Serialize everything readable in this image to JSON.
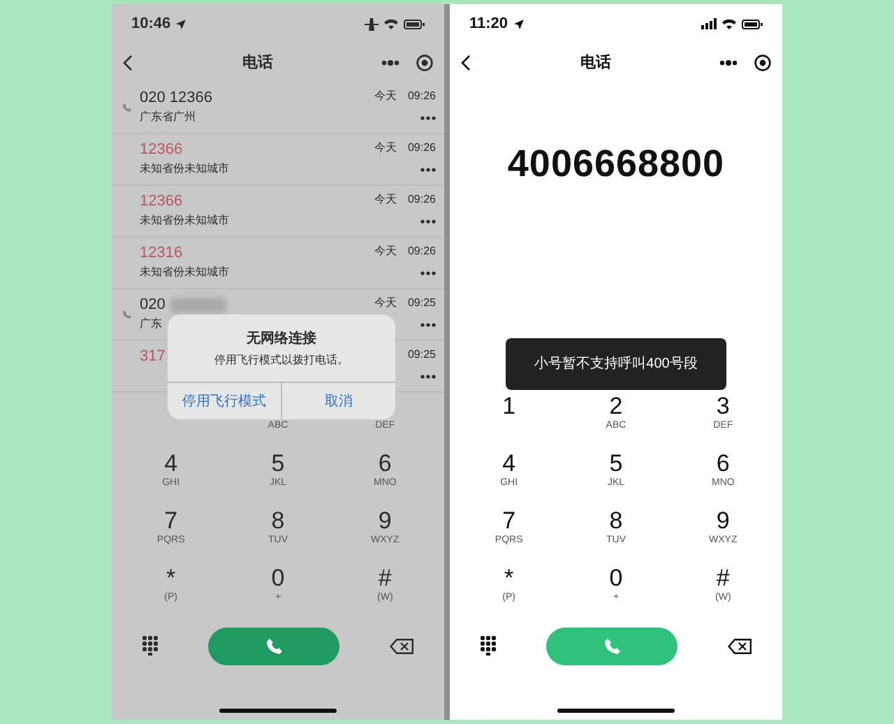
{
  "screens": [
    {
      "kind": "call_history",
      "dimmed": true,
      "status_bar": {
        "time": "10:46",
        "airplane_mode": true
      },
      "nav": {
        "title": "电话"
      },
      "calls": [
        {
          "number": "020 12366",
          "redacted": false,
          "location": "广东省广州",
          "date": "今天",
          "time": "09:26",
          "missed": false,
          "call_icon": true
        },
        {
          "number": "12366",
          "redacted": false,
          "location": "未知省份未知城市",
          "date": "今天",
          "time": "09:26",
          "missed": true,
          "call_icon": false
        },
        {
          "number": "12366",
          "redacted": false,
          "location": "未知省份未知城市",
          "date": "今天",
          "time": "09:26",
          "missed": true,
          "call_icon": false
        },
        {
          "number": "12316",
          "redacted": false,
          "location": "未知省份未知城市",
          "date": "今天",
          "time": "09:26",
          "missed": true,
          "call_icon": false
        },
        {
          "number": "020",
          "redacted": true,
          "location": "广东",
          "date": "今天",
          "time": "09:25",
          "missed": false,
          "call_icon": true
        },
        {
          "number": "317",
          "redacted": false,
          "time": "09:25",
          "missed": true,
          "call_icon": false
        }
      ],
      "keys": [
        {
          "kind": "covered"
        },
        {
          "kind": "letters_only",
          "letters": "ABC"
        },
        {
          "kind": "letters_only",
          "letters": "DEF"
        },
        {
          "kind": "key",
          "digit": "4",
          "letters": "GHI"
        },
        {
          "kind": "key",
          "digit": "5",
          "letters": "JKL"
        },
        {
          "kind": "key",
          "digit": "6",
          "letters": "MNO"
        },
        {
          "kind": "key",
          "digit": "7",
          "letters": "PQRS"
        },
        {
          "kind": "key",
          "digit": "8",
          "letters": "TUV"
        },
        {
          "kind": "key",
          "digit": "9",
          "letters": "WXYZ"
        },
        {
          "kind": "key",
          "digit": "*",
          "letters": "(P)"
        },
        {
          "kind": "key",
          "digit": "0",
          "letters": "+"
        },
        {
          "kind": "key",
          "digit": "#",
          "letters": "(W)"
        }
      ],
      "alert": {
        "title": "无网络连接",
        "message": "停用飞行模式以拨打电话。",
        "buttons": [
          "停用飞行模式",
          "取消"
        ]
      }
    },
    {
      "kind": "dialer",
      "dimmed": false,
      "status_bar": {
        "time": "11:20",
        "airplane_mode": false
      },
      "nav": {
        "title": "电话"
      },
      "display": "4006668800",
      "keys": [
        {
          "kind": "key",
          "digit": "1"
        },
        {
          "kind": "key",
          "digit": "2",
          "letters": "ABC"
        },
        {
          "kind": "key",
          "digit": "3",
          "letters": "DEF"
        },
        {
          "kind": "key",
          "digit": "4",
          "letters": "GHI"
        },
        {
          "kind": "key",
          "digit": "5",
          "letters": "JKL"
        },
        {
          "kind": "key",
          "digit": "6",
          "letters": "MNO"
        },
        {
          "kind": "key",
          "digit": "7",
          "letters": "PQRS"
        },
        {
          "kind": "key",
          "digit": "8",
          "letters": "TUV"
        },
        {
          "kind": "key",
          "digit": "9",
          "letters": "WXYZ"
        },
        {
          "kind": "key",
          "digit": "*",
          "letters": "(P)"
        },
        {
          "kind": "key",
          "digit": "0",
          "letters": "+"
        },
        {
          "kind": "key",
          "digit": "#",
          "letters": "(W)"
        }
      ],
      "toast": "小号暂不支持呼叫400号段"
    }
  ]
}
